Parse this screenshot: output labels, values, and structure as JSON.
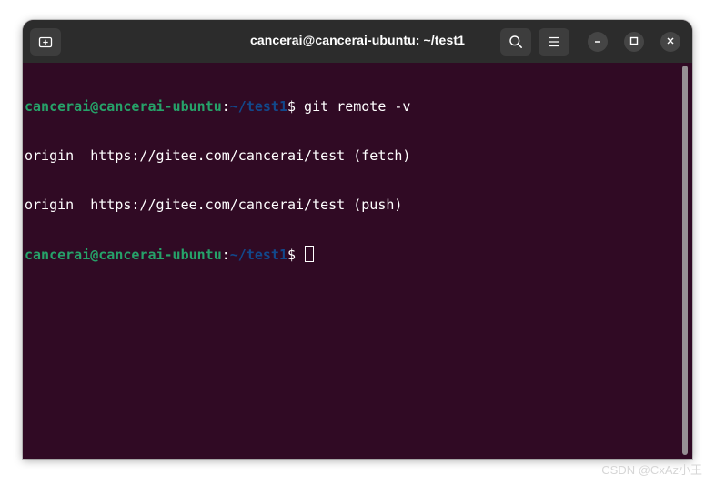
{
  "window": {
    "title": "cancerai@cancerai-ubuntu: ~/test1"
  },
  "titlebar": {
    "new_tab_icon": "new-tab-icon",
    "search_icon": "search-icon",
    "menu_icon": "hamburger-menu-icon",
    "minimize_icon": "minimize-icon",
    "maximize_icon": "maximize-icon",
    "close_icon": "close-icon"
  },
  "terminal": {
    "prompt": {
      "user_host": "cancerai@cancerai-ubuntu",
      "colon": ":",
      "path": "~/test1",
      "symbol": "$"
    },
    "lines": [
      {
        "command": " git remote -v"
      },
      {
        "output": "origin\thttps://gitee.com/cancerai/test (fetch)"
      },
      {
        "output": "origin\thttps://gitee.com/cancerai/test (push)"
      },
      {
        "command": " "
      }
    ]
  },
  "colors": {
    "background": "#300a24",
    "titlebar": "#2c2c2c",
    "prompt_user": "#26a269",
    "prompt_path": "#12488b",
    "text": "#ffffff"
  },
  "watermark": "CSDN @CxAz小王"
}
